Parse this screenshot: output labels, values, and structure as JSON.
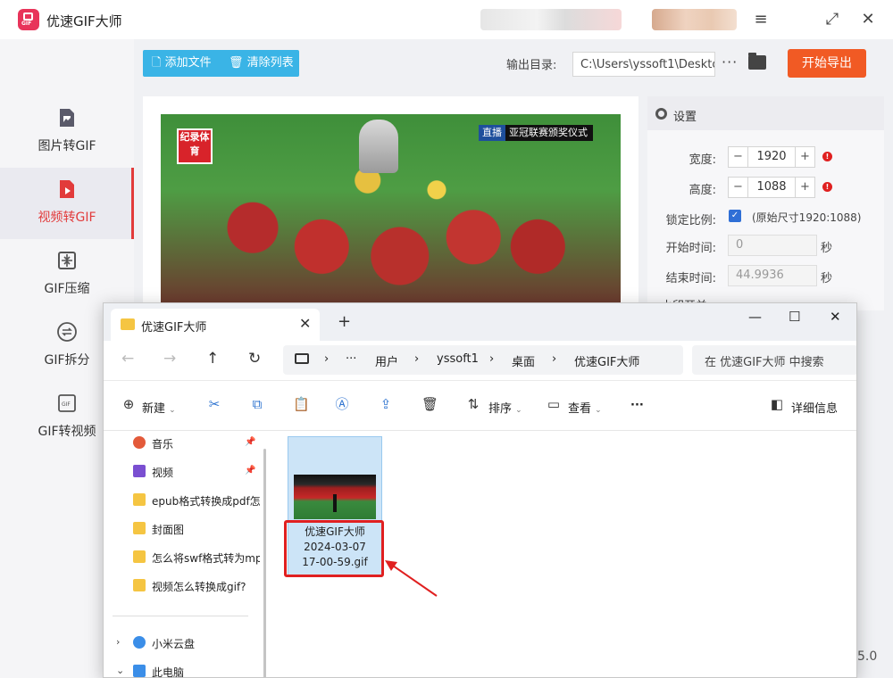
{
  "app": {
    "title": "优速GIF大师",
    "version": "5.0"
  },
  "sidebar": {
    "items": [
      {
        "label": "图片转GIF",
        "icon": "image-icon",
        "active": false
      },
      {
        "label": "视频转GIF",
        "icon": "video-icon",
        "active": true
      },
      {
        "label": "GIF压缩",
        "icon": "compress-icon",
        "active": false
      },
      {
        "label": "GIF拆分",
        "icon": "split-icon",
        "active": false
      },
      {
        "label": "GIF转视频",
        "icon": "gif-icon",
        "active": false
      }
    ]
  },
  "toolbar": {
    "add_file": "添加文件",
    "clear_list": "清除列表",
    "output_label": "输出目录:",
    "output_path": "C:\\Users\\yssoft1\\Deskto",
    "more": "···",
    "export": "开始导出"
  },
  "preview": {
    "seal_text": "纪录体育",
    "live_tag": "直播",
    "live_caption": "亚冠联赛颁奖仪式"
  },
  "settings": {
    "title": "设置",
    "width_label": "宽度:",
    "width_value": "1920",
    "height_label": "高度:",
    "height_value": "1088",
    "lock_label": "锁定比例:",
    "lock_checked": true,
    "original_size": "(原始尺寸1920:1088)",
    "start_label": "开始时间:",
    "start_value": "0",
    "end_label": "结束时间:",
    "end_value": "44.9936",
    "seconds": "秒",
    "watermark_label": "水印开关:"
  },
  "explorer": {
    "tab_title": "优速GIF大师",
    "breadcrumb": [
      "用户",
      "yssoft1",
      "桌面",
      "优速GIF大师"
    ],
    "search_placeholder": "在 优速GIF大师 中搜索",
    "toolbar": {
      "new": "新建",
      "sort": "排序",
      "view": "查看",
      "more": "···",
      "details": "详细信息"
    },
    "nav_items": [
      {
        "label": "音乐",
        "pinned": true
      },
      {
        "label": "视频",
        "pinned": true
      },
      {
        "label": "epub格式转换成pdf怎",
        "pinned": false
      },
      {
        "label": "封面图",
        "pinned": false
      },
      {
        "label": "怎么将swf格式转为mp",
        "pinned": false
      },
      {
        "label": "视频怎么转换成gif?",
        "pinned": false
      }
    ],
    "nav_cloud": "小米云盘",
    "nav_pc": "此电脑",
    "file": {
      "name_line1": "优速GIF大师",
      "name_line2": "2024-03-07",
      "name_line3": "17-00-59.gif"
    }
  },
  "colors": {
    "accent_red": "#e23b3b",
    "export_orange": "#f15a24",
    "button_blue": "#3ab4e6",
    "selection_blue": "#cce4f7"
  }
}
